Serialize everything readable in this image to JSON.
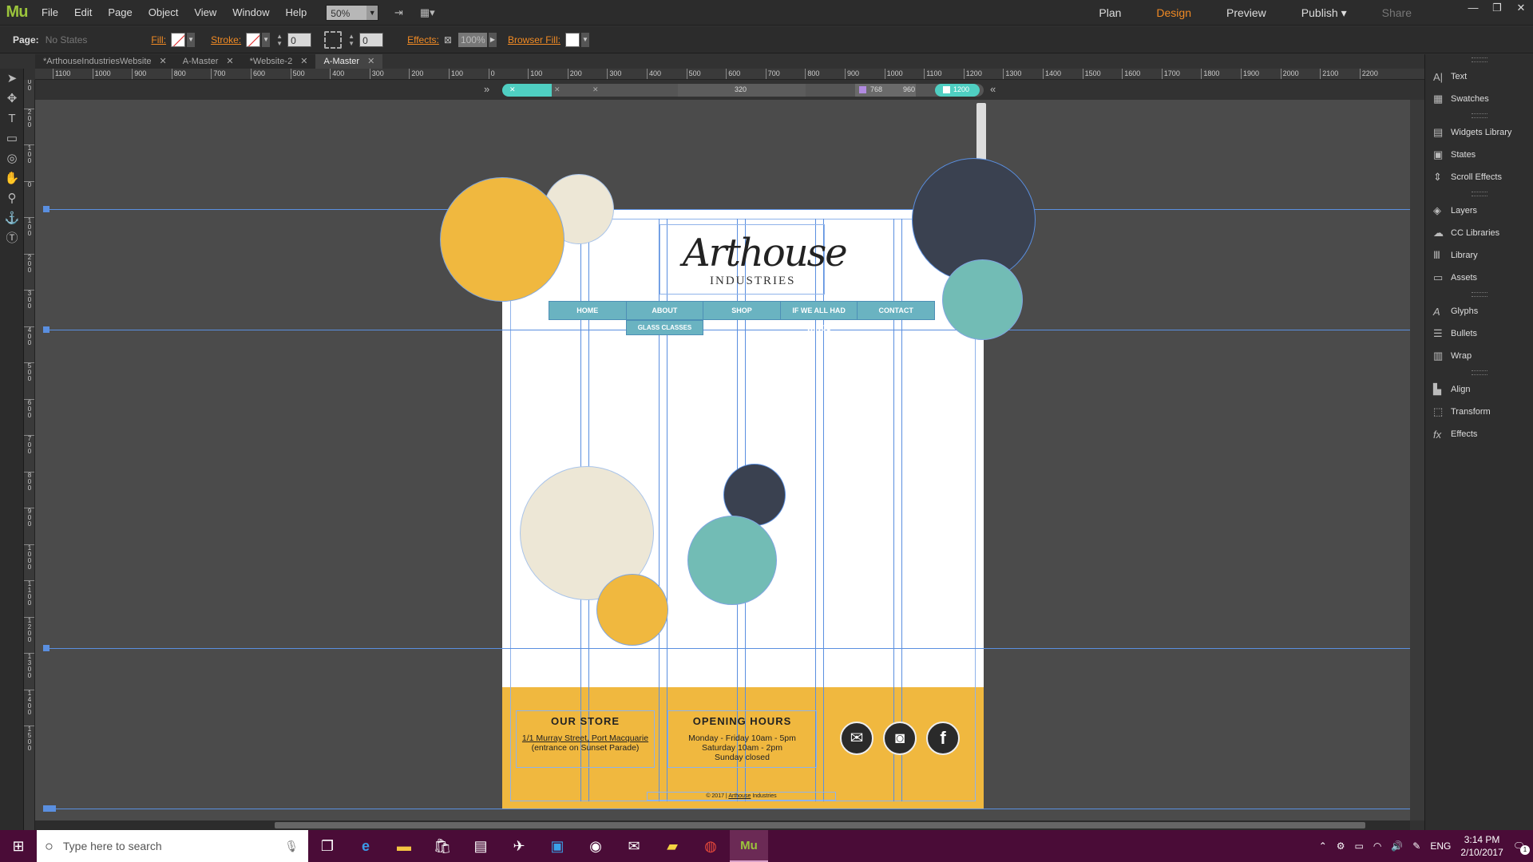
{
  "menubar": {
    "logo": "Mu",
    "items": [
      "File",
      "Edit",
      "Page",
      "Object",
      "View",
      "Window",
      "Help"
    ],
    "zoom": "50%",
    "modes": [
      "Plan",
      "Design",
      "Preview",
      "Publish",
      "Share"
    ]
  },
  "controlbar": {
    "page_label": "Page:",
    "state": "No States",
    "fill_label": "Fill:",
    "stroke_label": "Stroke:",
    "stroke_value": "0",
    "corner_value": "0",
    "effects_label": "Effects:",
    "opacity": "100%",
    "browser_fill_label": "Browser Fill:"
  },
  "tabs": [
    {
      "label": "*ArthouseIndustriesWebsite"
    },
    {
      "label": "A-Master"
    },
    {
      "label": "*Website-2"
    },
    {
      "label": "A-Master"
    }
  ],
  "ruler": {
    "h_labels": [
      "1100",
      "1000",
      "900",
      "800",
      "700",
      "600",
      "500",
      "400",
      "300",
      "200",
      "100",
      "0",
      "100",
      "200",
      "300",
      "400",
      "500",
      "600",
      "700",
      "800",
      "900",
      "1000",
      "1100",
      "1200",
      "1300",
      "1400",
      "1500",
      "1600",
      "1700",
      "1800",
      "1900",
      "2000",
      "2100",
      "2200"
    ],
    "v_labels": [
      "300",
      "200",
      "100",
      "0",
      "100",
      "200",
      "300",
      "400",
      "500",
      "600",
      "700",
      "800",
      "900",
      "1000",
      "1100",
      "1200",
      "1300",
      "1400",
      "1500"
    ]
  },
  "breakpoints": {
    "b320": "320",
    "b768": "768",
    "b960": "960",
    "b1200": "1200"
  },
  "site": {
    "logo_script": "Arthouse",
    "logo_caps": "INDUSTRIES",
    "nav": [
      "HOME",
      "ABOUT",
      "SHOP",
      "IF WE ALL HAD WINGS",
      "CONTACT"
    ],
    "subnav": "GLASS CLASSES",
    "store_title": "OUR STORE",
    "store_line1": "1/1 Murray Street, Port Macquarie",
    "store_line2": "(entrance on Sunset Parade)",
    "hours_title": "OPENING HOURS",
    "hours_line1": "Monday - Friday 10am - 5pm",
    "hours_line2": "Saturday 10am - 2pm",
    "hours_line3": "Sunday closed",
    "copyright_prefix": "© 2017 |",
    "copyright_link": "Arthouse",
    "copyright_suffix": "Industries"
  },
  "panel": [
    {
      "icon": "text-icon",
      "label": "Text",
      "glyph": "A|"
    },
    {
      "icon": "swatches-icon",
      "label": "Swatches",
      "glyph": "▦"
    },
    {
      "icon": "widgets-icon",
      "label": "Widgets Library",
      "glyph": "▤"
    },
    {
      "icon": "states-icon",
      "label": "States",
      "glyph": "▣"
    },
    {
      "icon": "scroll-effects-icon",
      "label": "Scroll Effects",
      "glyph": "⇕"
    },
    {
      "icon": "layers-icon",
      "label": "Layers",
      "glyph": "◈"
    },
    {
      "icon": "cc-libraries-icon",
      "label": "CC Libraries",
      "glyph": "☁"
    },
    {
      "icon": "library-icon",
      "label": "Library",
      "glyph": "Ⅲ"
    },
    {
      "icon": "assets-icon",
      "label": "Assets",
      "glyph": "▭"
    },
    {
      "icon": "glyphs-icon",
      "label": "Glyphs",
      "glyph": "A"
    },
    {
      "icon": "bullets-icon",
      "label": "Bullets",
      "glyph": "☰"
    },
    {
      "icon": "wrap-icon",
      "label": "Wrap",
      "glyph": "▥"
    },
    {
      "icon": "align-icon",
      "label": "Align",
      "glyph": "▙"
    },
    {
      "icon": "transform-icon",
      "label": "Transform",
      "glyph": "⬚"
    },
    {
      "icon": "effects-icon",
      "label": "Effects",
      "glyph": "fx"
    }
  ],
  "taskbar": {
    "search_placeholder": "Type here to search",
    "lang": "ENG",
    "time": "3:14 PM",
    "date": "2/10/2017",
    "notif_count": "1"
  },
  "colors": {
    "accent": "#f08a24",
    "yellow": "#f0b83f",
    "teal": "#72bcb5",
    "navy": "#3a4150",
    "cream": "#ede7d6",
    "guide": "#5a8fe0"
  }
}
